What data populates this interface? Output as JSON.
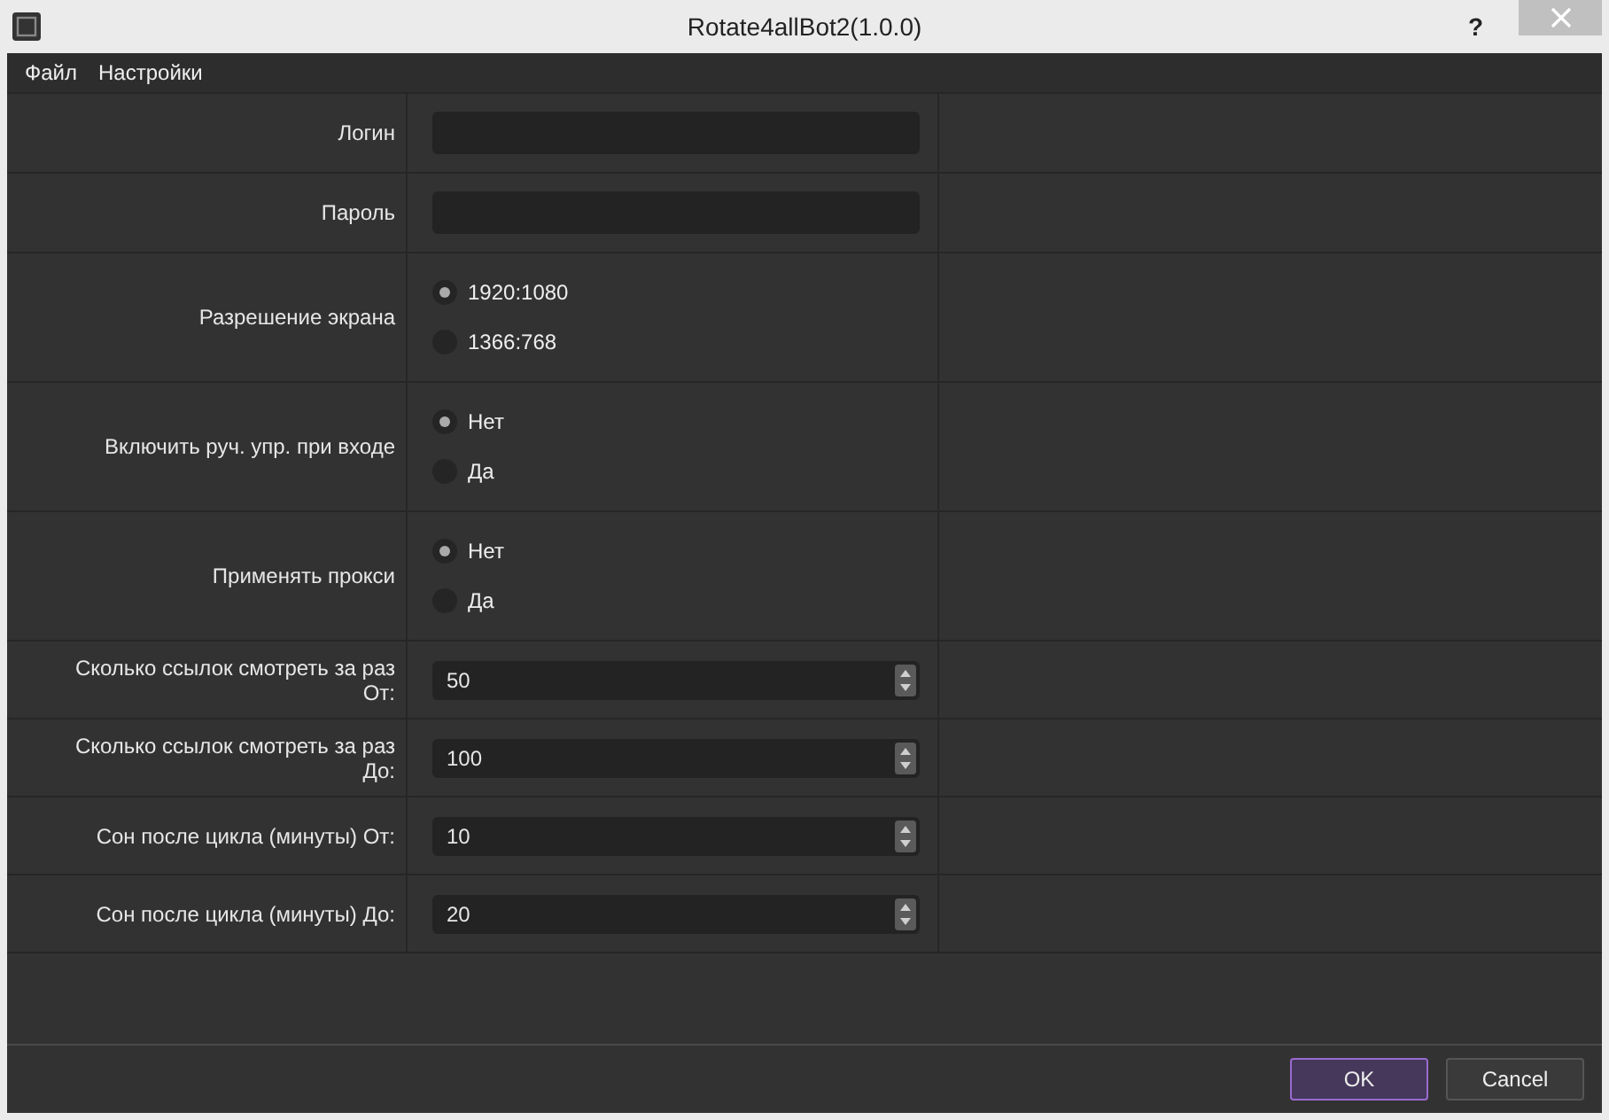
{
  "window": {
    "title": "Rotate4allBot2(1.0.0)",
    "help": "?"
  },
  "menu": [
    "Файл",
    "Настройки"
  ],
  "form": [
    {
      "kind": "text",
      "label": "Логин"
    },
    {
      "kind": "text",
      "label": "Пароль"
    },
    {
      "kind": "radio",
      "label": "Разрешение экрана",
      "options": [
        {
          "label": "1920:1080",
          "selected": true
        },
        {
          "label": "1366:768",
          "selected": false
        }
      ]
    },
    {
      "kind": "radio",
      "label": "Включить руч. упр. при входе",
      "options": [
        {
          "label": "Нет",
          "selected": true
        },
        {
          "label": "Да",
          "selected": false
        }
      ]
    },
    {
      "kind": "radio",
      "label": "Применять прокси",
      "options": [
        {
          "label": "Нет",
          "selected": true
        },
        {
          "label": "Да",
          "selected": false
        }
      ]
    },
    {
      "kind": "spin",
      "label": "Сколько ссылок смотреть за раз От:",
      "value": "50"
    },
    {
      "kind": "spin",
      "label": "Сколько ссылок смотреть за раз До:",
      "value": "100"
    },
    {
      "kind": "spin",
      "label": "Сон после цикла (минуты) От:",
      "value": "10"
    },
    {
      "kind": "spin",
      "label": "Сон после цикла (минуты) До:",
      "value": "20"
    }
  ],
  "buttons": [
    {
      "label": "OK",
      "focused": true
    },
    {
      "label": "Cancel",
      "focused": false
    }
  ]
}
